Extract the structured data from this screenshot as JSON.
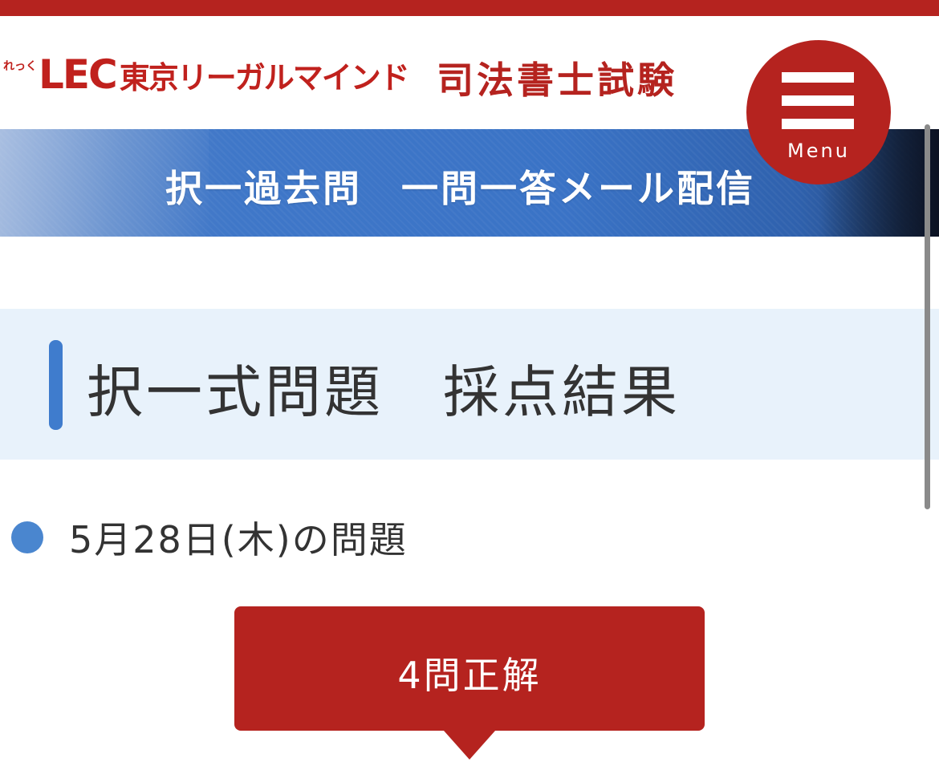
{
  "header": {
    "logo_kana": "れっく",
    "logo_mark": "LEC",
    "logo_company": "東京リーガルマインド",
    "site_title": "司法書士試験",
    "menu_label": "Menu"
  },
  "banner": {
    "title": "択一過去問　一問一答メール配信"
  },
  "section": {
    "heading": "択一式問題　採点結果"
  },
  "question": {
    "date_label": "5月28日(木)の問題"
  },
  "result": {
    "label": "4問正解"
  },
  "colors": {
    "brand_red": "#b5231f",
    "accent_blue": "#3f7ccd",
    "heading_bg": "#e8f2fb",
    "text_dark": "#333333"
  },
  "icons": {
    "menu": "hamburger-icon",
    "bullet": "bullet-dot-icon",
    "arrow": "triangle-down-icon"
  }
}
